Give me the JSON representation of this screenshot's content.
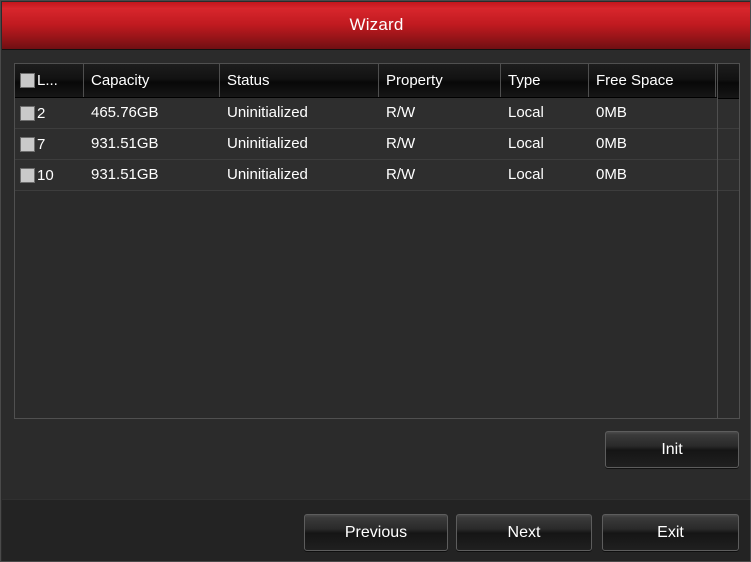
{
  "window": {
    "title": "Wizard",
    "titlebar_color_top": "#d8262c",
    "titlebar_color_bottom": "#6f0f13"
  },
  "table": {
    "select_all_checked": false,
    "columns": [
      {
        "key": "label",
        "header": "L...",
        "has_checkbox": true
      },
      {
        "key": "capacity",
        "header": "Capacity"
      },
      {
        "key": "status",
        "header": "Status"
      },
      {
        "key": "property",
        "header": "Property"
      },
      {
        "key": "type",
        "header": "Type"
      },
      {
        "key": "free_space",
        "header": "Free Space"
      }
    ],
    "rows": [
      {
        "checked": false,
        "label": "2",
        "capacity": "465.76GB",
        "status": "Uninitialized",
        "property": "R/W",
        "type": "Local",
        "free_space": "0MB"
      },
      {
        "checked": false,
        "label": "7",
        "capacity": "931.51GB",
        "status": "Uninitialized",
        "property": "R/W",
        "type": "Local",
        "free_space": "0MB"
      },
      {
        "checked": false,
        "label": "10",
        "capacity": "931.51GB",
        "status": "Uninitialized",
        "property": "R/W",
        "type": "Local",
        "free_space": "0MB"
      }
    ]
  },
  "actions": {
    "init_label": "Init"
  },
  "footer": {
    "previous_label": "Previous",
    "next_label": "Next",
    "exit_label": "Exit"
  }
}
